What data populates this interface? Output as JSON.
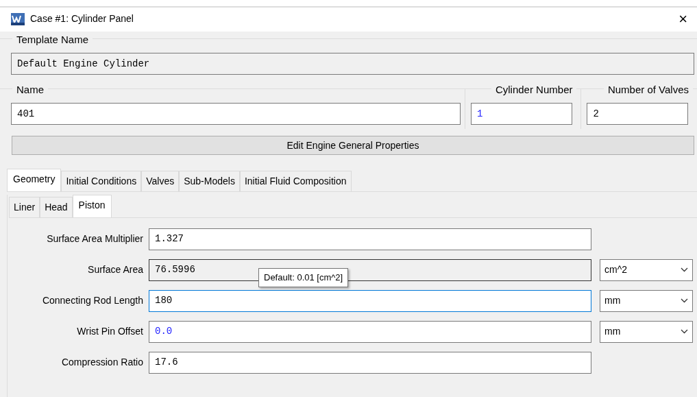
{
  "window": {
    "title": "Case #1: Cylinder Panel",
    "close": "×"
  },
  "template": {
    "label": "Template Name",
    "value": "Default Engine Cylinder"
  },
  "header_fields": [
    {
      "label": "Name",
      "value": "401",
      "is_default": false
    },
    {
      "label": "Cylinder Number",
      "value": "1",
      "is_default": true
    },
    {
      "label": "Number of Valves",
      "value": "2",
      "is_default": false
    }
  ],
  "edit_button": "Edit Engine General Properties",
  "tabs": [
    {
      "label": "Geometry",
      "selected": true
    },
    {
      "label": "Initial Conditions",
      "selected": false
    },
    {
      "label": "Valves",
      "selected": false
    },
    {
      "label": "Sub-Models",
      "selected": false
    },
    {
      "label": "Initial Fluid Composition",
      "selected": false
    }
  ],
  "sub_tabs": [
    {
      "label": "Liner",
      "selected": false
    },
    {
      "label": "Head",
      "selected": false
    },
    {
      "label": "Piston",
      "selected": true
    }
  ],
  "rows": [
    {
      "label": "Surface Area Multiplier",
      "value": "1.327",
      "is_default": false,
      "readonly": false,
      "focused": false
    },
    {
      "label": "Surface Area",
      "value": "76.5996",
      "is_default": false,
      "readonly": true,
      "focused": false,
      "unit": "cm^2"
    },
    {
      "label": "Connecting Rod Length",
      "value": "180",
      "is_default": false,
      "readonly": false,
      "focused": true,
      "unit": "mm"
    },
    {
      "label": "Wrist Pin Offset",
      "value": "0.0",
      "is_default": true,
      "readonly": false,
      "focused": false,
      "unit": "mm"
    },
    {
      "label": "Compression Ratio",
      "value": "17.6",
      "is_default": false,
      "readonly": false,
      "focused": false
    }
  ],
  "tooltip": "Default: 0.01 [cm^2]"
}
